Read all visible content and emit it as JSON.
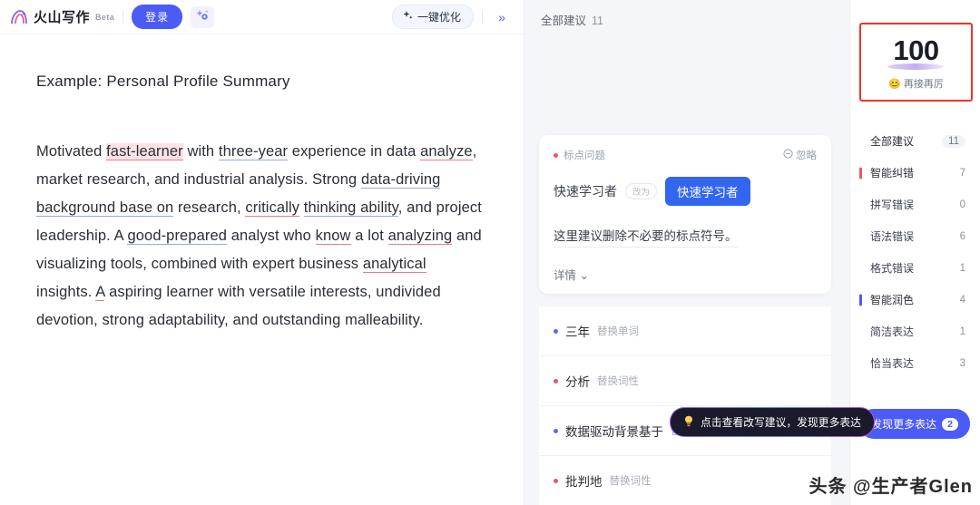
{
  "header": {
    "brand_name": "火山写作",
    "beta_label": "Beta",
    "login_label": "登录",
    "wand_icon": "magic-wand-icon",
    "optimize_label": "一键优化",
    "sparkle_icon": "sparkle-icon",
    "collapse_label": "»"
  },
  "document": {
    "title": "Example: Personal Profile Summary",
    "paragraph": {
      "s1": "Motivated ",
      "m1": "fast-learner",
      "s2": " with ",
      "m2": "three-year",
      "s3": " experience in data ",
      "m3": "analyze",
      "s4": ", market research, and industrial analysis. Strong ",
      "m4": "data-driving background base on",
      "s5": " research, ",
      "m5": "critically",
      "s6": " ",
      "m6": "thinking ability",
      "s7": ", and project leadership. A ",
      "m7": "good-prepared",
      "s8": " analyst who ",
      "m8": "know",
      "s9": " a lot ",
      "m9": "analyzing",
      "s10": " and visualizing tools, combined with expert business ",
      "m10": "analytical",
      "s11": " insights. ",
      "m11": "A",
      "s12": " aspiring learner with versatile interests, undivided devotion, strong adaptability, and outstanding malleability."
    }
  },
  "suggestions": {
    "header_label": "全部建议",
    "header_count": "11",
    "card": {
      "tag": "标点问题",
      "ignore_label": "忽略",
      "ignore_icon": "circle-minus-icon",
      "from_text": "快速学习者",
      "arrow_label": "改为",
      "to_text": "快速学习者",
      "description": "这里建议删除不必要的标点符号。",
      "more_label": "详情",
      "chevron_icon": "chevron-down-icon"
    },
    "items": [
      {
        "word": "三年",
        "kind": "替换单词",
        "dot": "blue"
      },
      {
        "word": "分析",
        "kind": "替换词性",
        "dot": "red"
      },
      {
        "word": "数据驱动背景基于",
        "kind": "替换短语",
        "dot": "blue"
      },
      {
        "word": "批判地",
        "kind": "替换词性",
        "dot": "red"
      }
    ],
    "tooltip": {
      "text": "点击查看改写建议，发现更多表达",
      "icon": "lightbulb-icon"
    }
  },
  "sidebar": {
    "score": {
      "value": "100",
      "caption": "再接再厉",
      "emoji": "😊"
    },
    "rows": [
      {
        "label": "全部建议",
        "count": "11",
        "style": "head",
        "bar": "none"
      },
      {
        "label": "智能纠错",
        "count": "7",
        "style": "group",
        "bar": "red"
      },
      {
        "label": "拼写错误",
        "count": "0",
        "style": "sub",
        "bar": "none"
      },
      {
        "label": "语法错误",
        "count": "6",
        "style": "sub",
        "bar": "none"
      },
      {
        "label": "格式错误",
        "count": "1",
        "style": "sub",
        "bar": "none"
      },
      {
        "label": "智能润色",
        "count": "4",
        "style": "group",
        "bar": "blue"
      },
      {
        "label": "简洁表达",
        "count": "1",
        "style": "sub",
        "bar": "none"
      },
      {
        "label": "恰当表达",
        "count": "3",
        "style": "sub",
        "bar": "none"
      }
    ],
    "discover": {
      "label": "发现更多表达",
      "count": "2"
    }
  },
  "watermark": "头条 @生产者Glen",
  "colors": {
    "accent": "#4b5bf5",
    "error": "#f2555f",
    "highlight_box": "#f2322b",
    "replace_button": "#3366ef"
  }
}
